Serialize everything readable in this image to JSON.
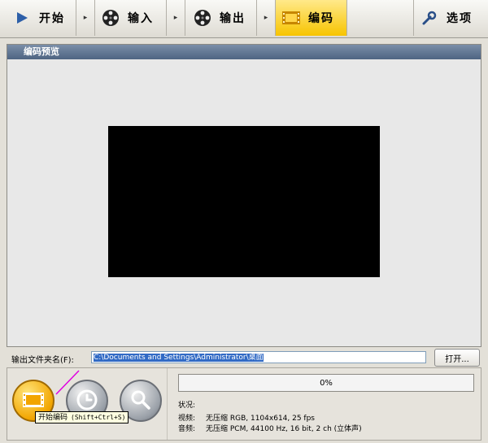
{
  "wizard": {
    "steps": [
      {
        "label": "开始",
        "icon": "play-icon"
      },
      {
        "label": "输入",
        "icon": "film-reel-icon"
      },
      {
        "label": "输出",
        "icon": "film-reel-icon"
      },
      {
        "label": "编码",
        "icon": "film-strip-icon",
        "active": true
      },
      {
        "label": "选项",
        "icon": "wrench-icon"
      }
    ],
    "arrow_glyph": "▸"
  },
  "preview": {
    "title": "编码预览"
  },
  "output_folder": {
    "label": "输出文件夹名(F):",
    "value": "C:\\Documents and Settings\\Administrator\\桌面",
    "open_button": "打开..."
  },
  "actions": {
    "encode_tooltip": "开始编码",
    "encode_shortcut": "(Shift+Ctrl+S)"
  },
  "progress": {
    "value_percent": 0,
    "label": "0%"
  },
  "status": {
    "label": "状况:",
    "video_label": "视频:",
    "video_value": "无压缩 RGB, 1104x614, 25 fps",
    "audio_label": "音频:",
    "audio_value": "无压缩 PCM, 44100 Hz, 16 bit, 2 ch (立体声)"
  },
  "colors": {
    "active_step": "#f7c400",
    "header_bar": "#4e6482",
    "progress_fill": "#3a9a3a"
  }
}
